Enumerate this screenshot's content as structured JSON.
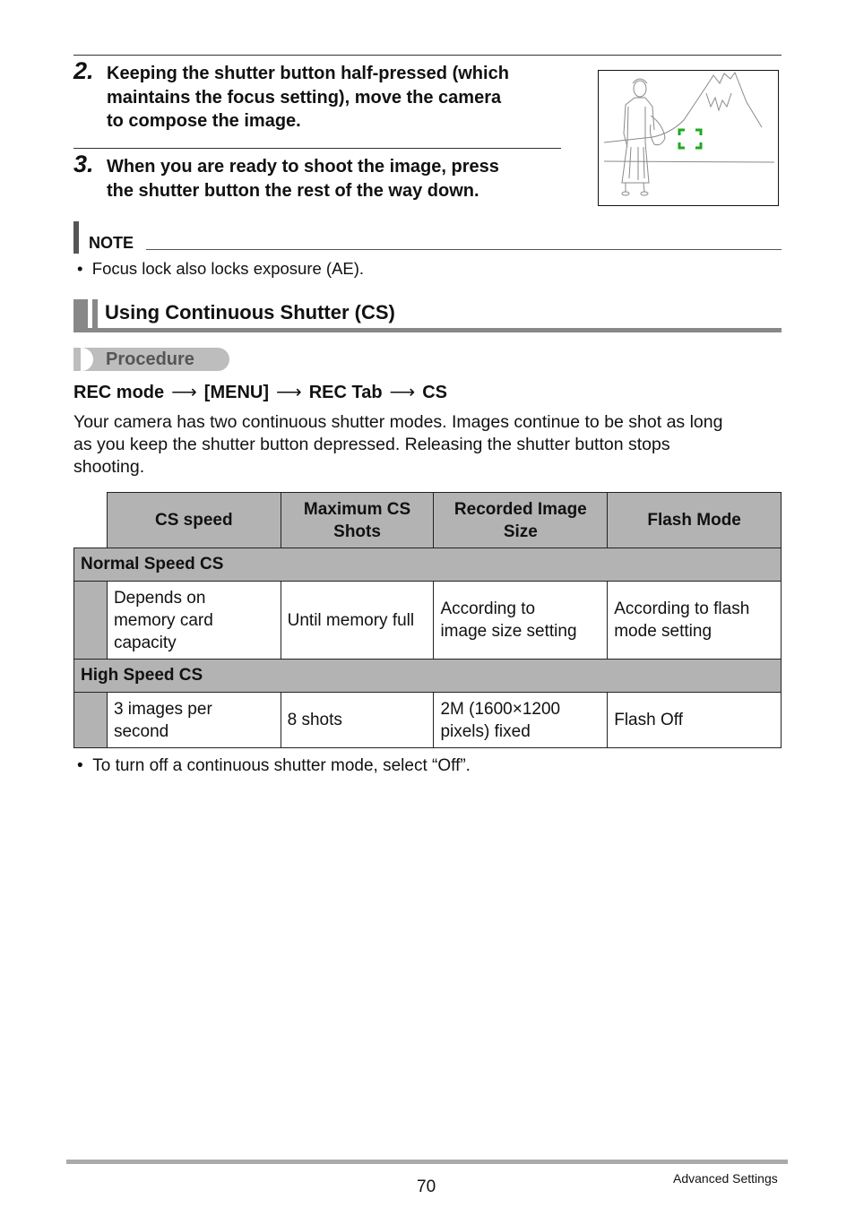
{
  "steps": [
    {
      "number": "2.",
      "text": [
        "Keeping the shutter button half-pressed (which",
        "maintains the focus setting), move the camera",
        "to compose the image."
      ]
    },
    {
      "number": "3.",
      "text": [
        "When you are ready to shoot the image, press",
        "the shutter button the rest of the way down."
      ]
    }
  ],
  "illustration": {
    "description": "woman-and-mountain-with-focus-frame",
    "focus_frame_color": "#1fa81f"
  },
  "note": {
    "label": "NOTE",
    "bullets": [
      "Focus lock also locks exposure (AE)."
    ]
  },
  "section": {
    "title": "Using Continuous Shutter (CS)",
    "procedure_label": "Procedure",
    "path": [
      "REC mode",
      "[MENU]",
      "REC Tab",
      "CS"
    ],
    "path_arrow": "⟶",
    "body": [
      "Your camera has two continuous shutter modes. Images continue to be shot as long",
      "as you keep the shutter button depressed. Releasing the shutter button stops",
      "shooting."
    ]
  },
  "table": {
    "headers": [
      [
        "CS speed"
      ],
      [
        "Maximum CS",
        "Shots"
      ],
      [
        "Recorded Image",
        "Size"
      ],
      [
        "Flash Mode"
      ]
    ],
    "groups": [
      {
        "name": "Normal Speed CS",
        "cells": [
          [
            "Depends on",
            "memory card",
            "capacity"
          ],
          [
            "Until memory full"
          ],
          [
            "According to",
            "image size setting"
          ],
          [
            "According to flash",
            "mode setting"
          ]
        ]
      },
      {
        "name": "High Speed CS",
        "cells": [
          [
            "3 images per",
            "second"
          ],
          [
            "8 shots"
          ],
          [
            "2M (1600×1200",
            "pixels) fixed"
          ],
          [
            "Flash Off"
          ]
        ]
      }
    ]
  },
  "after_table_bullets": [
    "To turn off a continuous shutter mode, select “Off”."
  ],
  "footer": {
    "page_number": "70",
    "section_name": "Advanced Settings"
  },
  "colors": {
    "table_header_bg": "#b3b3b3",
    "section_bar": "#888888",
    "procedure_pill": "#bdbdbd"
  }
}
